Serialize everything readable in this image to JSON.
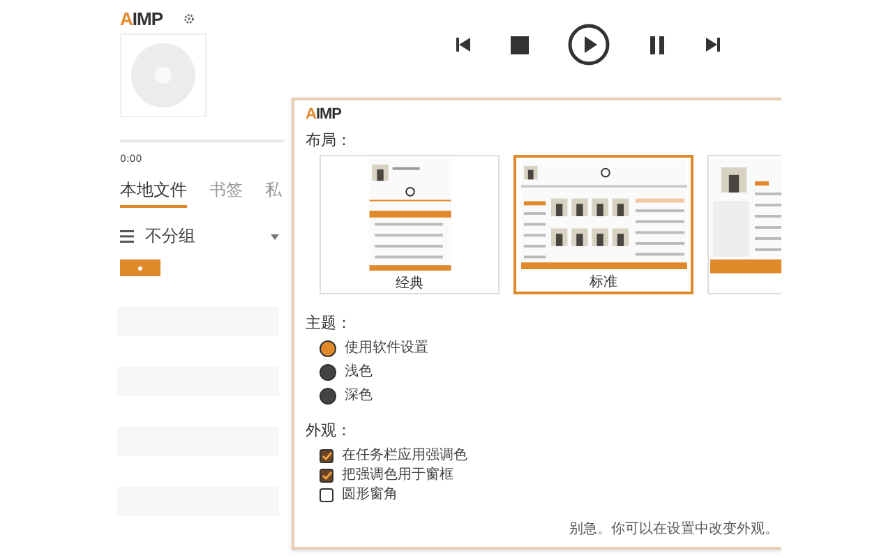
{
  "player": {
    "logo": "AIMP",
    "time": "0:00",
    "tabs": [
      {
        "label": "本地文件",
        "selected": true
      },
      {
        "label": "书签",
        "selected": false
      },
      {
        "label": "私",
        "selected": false
      }
    ],
    "grouping": "不分组"
  },
  "dialog": {
    "logo": "AIMP",
    "layout_heading": "布局：",
    "layouts": [
      {
        "kind": "classic",
        "label": "经典",
        "selected": false
      },
      {
        "kind": "standard",
        "label": "标准",
        "selected": true
      },
      {
        "kind": "sidebar",
        "selected": false
      }
    ],
    "theme_heading": "主题：",
    "themes": [
      {
        "label": "使用软件设置",
        "selected": true
      },
      {
        "label": "浅色",
        "selected": false
      },
      {
        "label": "深色",
        "selected": false
      }
    ],
    "appearance_heading": "外观：",
    "options": [
      {
        "label": "在任务栏应用强调色",
        "checked": true
      },
      {
        "label": "把强调色用于窗框",
        "checked": true
      },
      {
        "label": "圆形窗角",
        "checked": false
      }
    ],
    "footer": "别急。你可以在设置中改变外观。"
  }
}
